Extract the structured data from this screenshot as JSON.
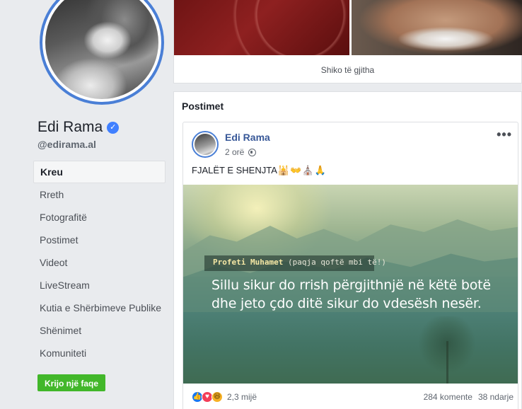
{
  "profile": {
    "name": "Edi Rama",
    "handle": "@edirama.al"
  },
  "nav": {
    "items": [
      {
        "label": "Kreu"
      },
      {
        "label": "Rreth"
      },
      {
        "label": "Fotografitë"
      },
      {
        "label": "Postimet"
      },
      {
        "label": "Videot"
      },
      {
        "label": "LiveStream"
      },
      {
        "label": "Kutia e Shërbimeve Publike"
      },
      {
        "label": "Shënimet"
      },
      {
        "label": "Komuniteti"
      }
    ],
    "create_page_label": "Krijo një faqe"
  },
  "photos": {
    "see_all_label": "Shiko të gjitha"
  },
  "posts": {
    "title": "Postimet",
    "post": {
      "author": "Edi Rama",
      "time": "2 orë",
      "text": "FJALËT E SHENJTA",
      "emojis": "🕌👐⛪🙏",
      "image": {
        "attribution": "Profeti Muhamet",
        "attribution_paren": "(paqja qoftë mbi të!)",
        "quote_line_1": "Sillu sikur do rrish përgjithnjë në këtë botë",
        "quote_line_2": "dhe jeto çdo ditë sikur do vdesësh nesër."
      },
      "reactions_count": "2,3 mijë",
      "comments": "284 komente",
      "shares": "38 ndarje"
    }
  },
  "colors": {
    "accent_blue": "#4a7fd6",
    "link_blue": "#385898",
    "create_green": "#42b72a",
    "page_bg": "#e9ebee"
  },
  "icons": {
    "verified": "verified-badge-icon",
    "globe": "globe-icon",
    "more": "more-options-icon",
    "like": "like-reaction-icon",
    "love": "love-reaction-icon",
    "haha": "haha-reaction-icon"
  }
}
